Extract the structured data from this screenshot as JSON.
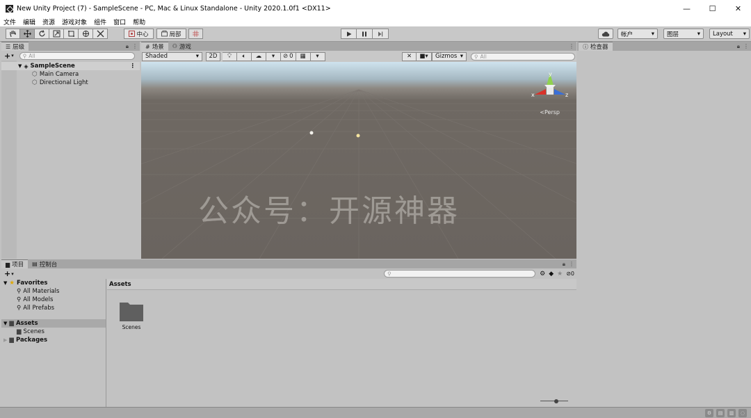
{
  "window": {
    "title": "New Unity Project (7) - SampleScene - PC, Mac & Linux Standalone - Unity 2020.1.0f1 <DX11>",
    "controls": [
      "—",
      "☐",
      "✕"
    ]
  },
  "menu": [
    "文件",
    "编辑",
    "资源",
    "游戏对象",
    "组件",
    "窗口",
    "帮助"
  ],
  "toolbar": {
    "pivot_label": "中心",
    "space_label": "局部",
    "account_label": "帐户",
    "layers_label": "图层",
    "layout_label": "Layout"
  },
  "hierarchy": {
    "tab_label": "层级",
    "search_placeholder": "All",
    "scene_name": "SampleScene",
    "items": [
      "Main Camera",
      "Directional Light"
    ]
  },
  "scene_view": {
    "tabs": [
      "场景",
      "游戏"
    ],
    "shading_mode": "Shaded",
    "mode_2d_label": "2D",
    "hidden_count": "0",
    "gizmos_label": "Gizmos",
    "search_placeholder": "All",
    "projection_label": "Persp",
    "axis_labels": {
      "x": "x",
      "y": "y",
      "z": "z"
    },
    "watermark": "公众号：开源神器"
  },
  "inspector": {
    "tab_label": "检查器"
  },
  "project": {
    "tabs": [
      "项目",
      "控制台"
    ],
    "favorites_label": "Favorites",
    "favorites": [
      "All Materials",
      "All Models",
      "All Prefabs"
    ],
    "assets_label": "Assets",
    "asset_children": [
      "Scenes"
    ],
    "packages_label": "Packages",
    "breadcrumb": "Assets",
    "hidden_count": "0",
    "folder_items": [
      "Scenes"
    ]
  }
}
